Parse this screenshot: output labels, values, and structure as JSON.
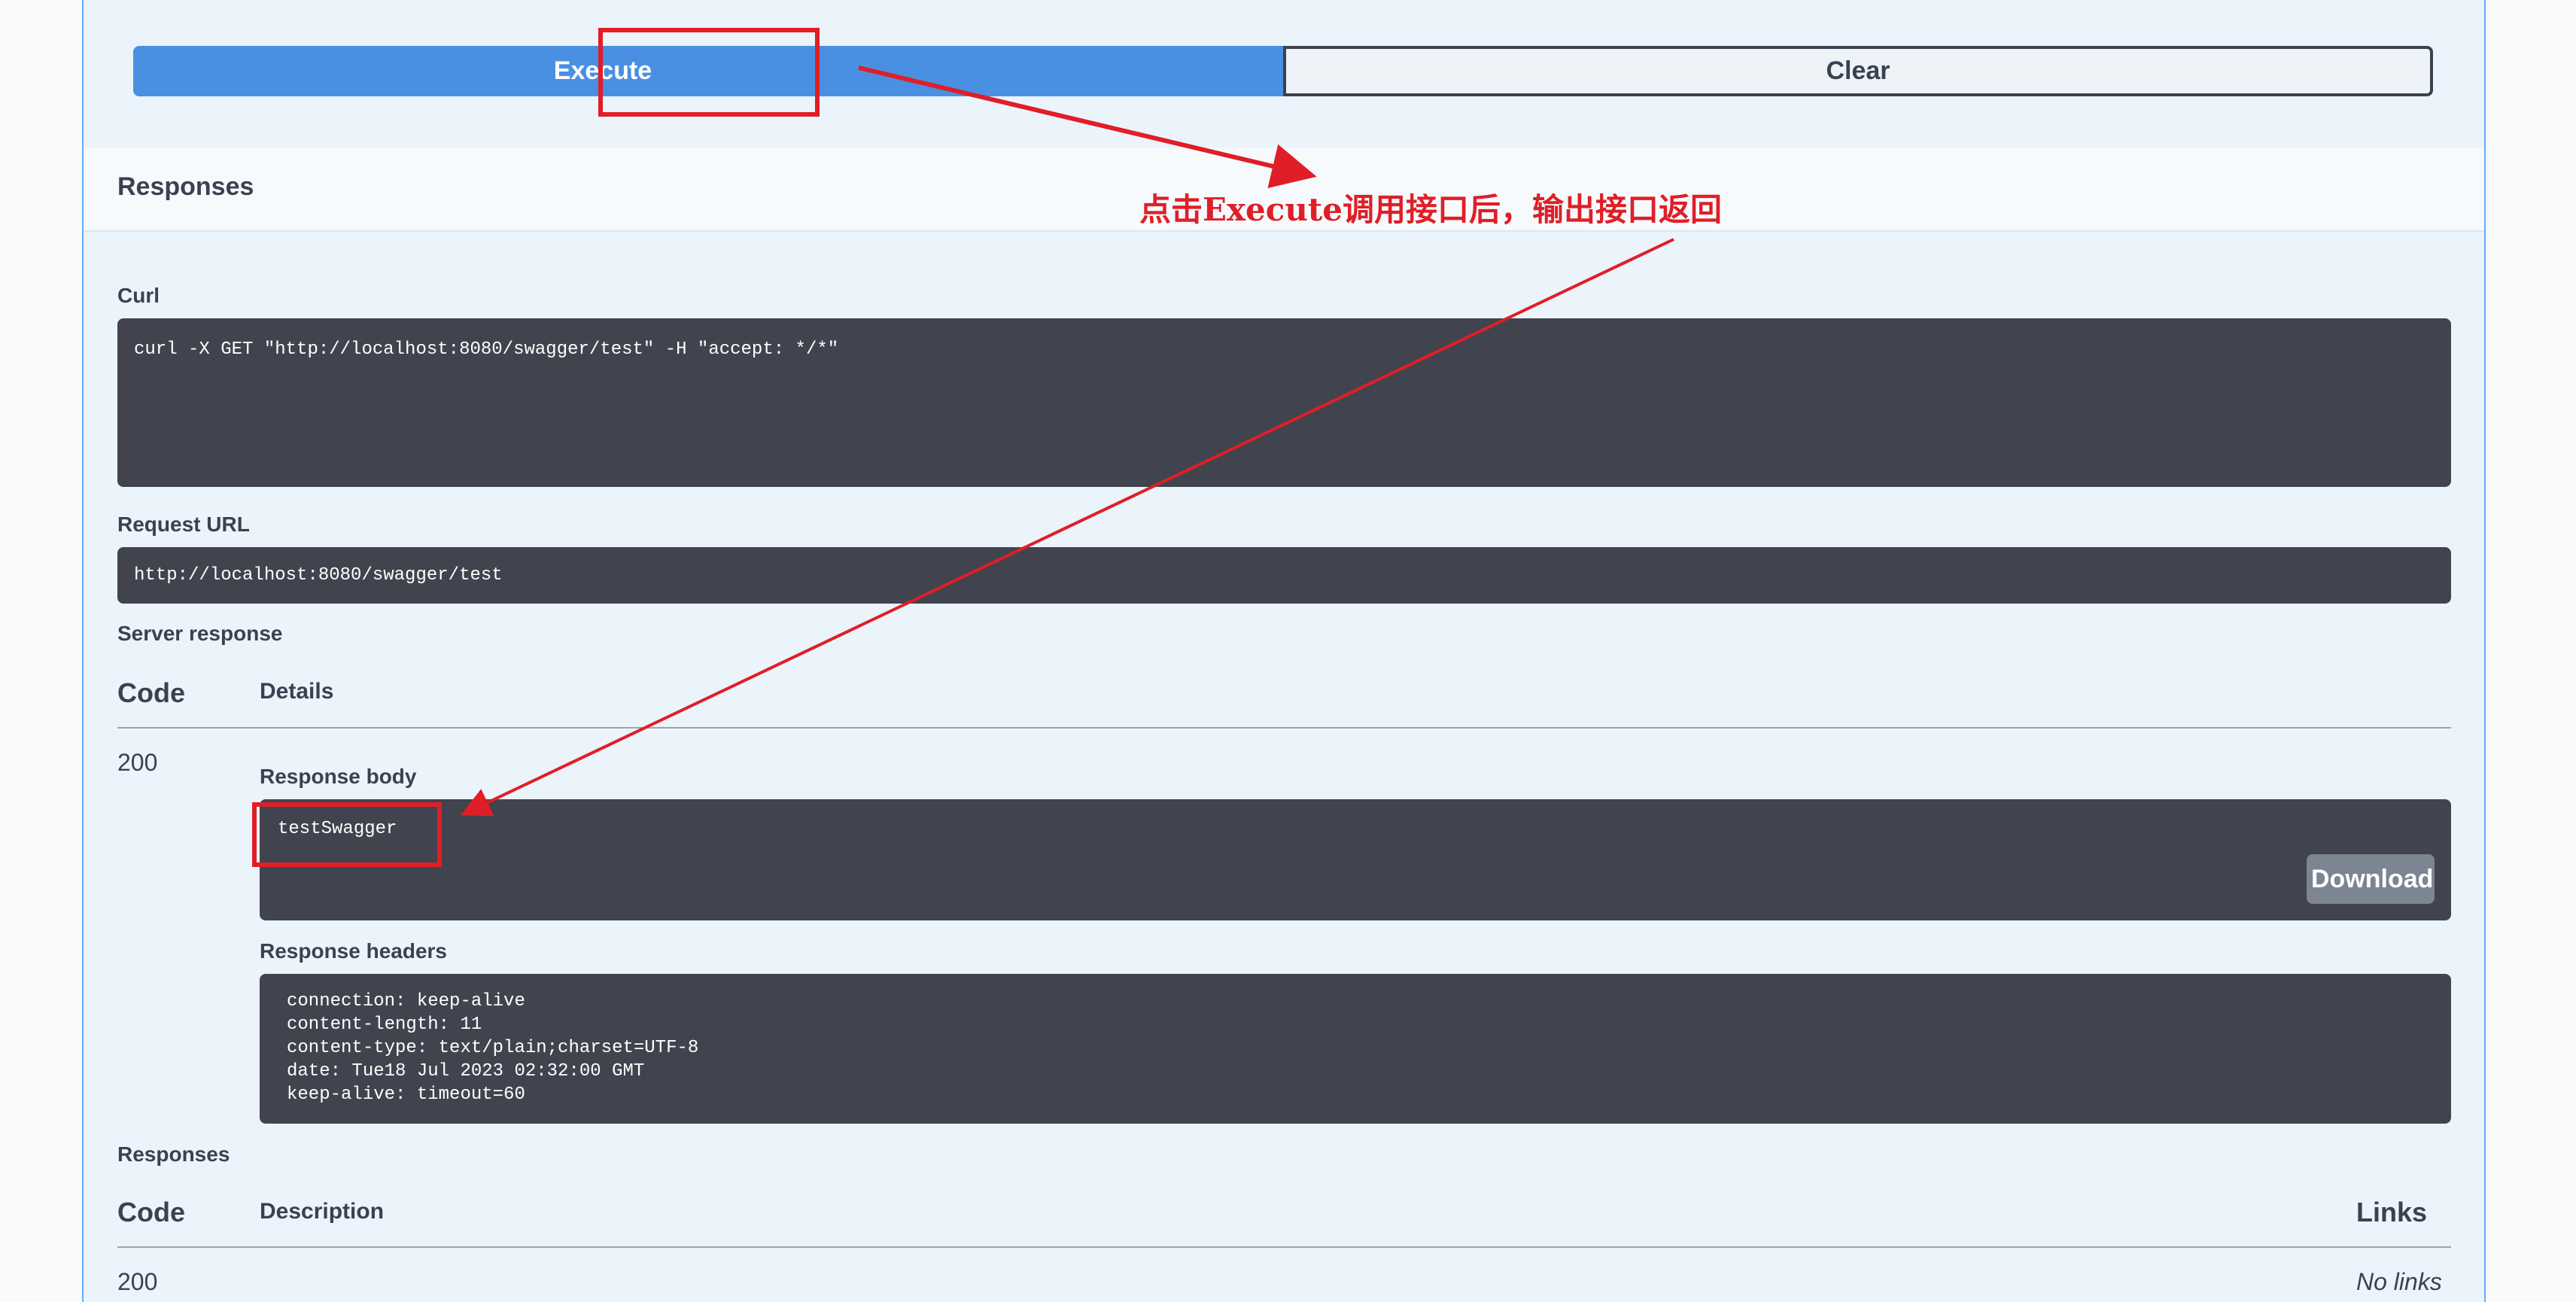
{
  "buttons": {
    "execute": "Execute",
    "clear": "Clear"
  },
  "responses_section": {
    "title": "Responses"
  },
  "curl": {
    "label": "Curl",
    "command": "curl -X GET \"http://localhost:8080/swagger/test\" -H \"accept: */*\""
  },
  "request_url": {
    "label": "Request URL",
    "value": "http://localhost:8080/swagger/test"
  },
  "server_response": {
    "label": "Server response",
    "code_header": "Code",
    "details_header": "Details",
    "code": "200",
    "body_label": "Response body",
    "body": "testSwagger",
    "download": "Download",
    "headers_label": "Response headers",
    "headers": "connection: keep-alive\ncontent-length: 11\ncontent-type: text/plain;charset=UTF-8\ndate: Tue18 Jul 2023 02:32:00 GMT\nkeep-alive: timeout=60"
  },
  "responses_table": {
    "label": "Responses",
    "code_header": "Code",
    "description_header": "Description",
    "links_header": "Links",
    "row_code": "200",
    "row_links": "No links"
  },
  "annotation": {
    "text": "点击Execute调用接口后，输出接口返回",
    "color": "#e01e27"
  }
}
